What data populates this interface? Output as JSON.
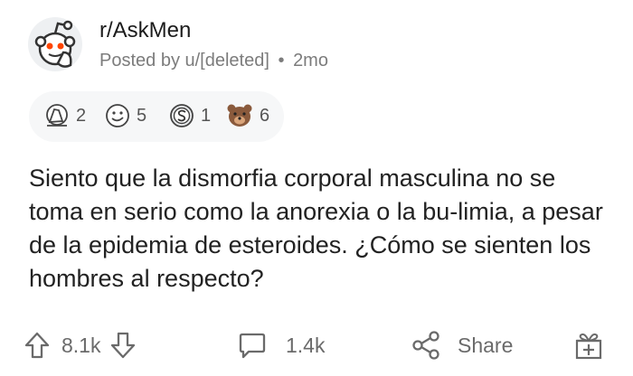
{
  "post": {
    "subreddit": "r/AskMen",
    "posted_by": "Posted by u/[deleted]",
    "separator": "•",
    "age": "2mo",
    "text": "Siento que la dismorfia corporal masculina no se toma en serio como la anorexia o la bu-limia, a pesar de la epidemia de esteroides. ¿Cómo se sienten los hombres al respecto?"
  },
  "awards": [
    {
      "icon": "facepalm-award-icon",
      "count": "2"
    },
    {
      "icon": "smile-face-award-icon",
      "count": "5"
    },
    {
      "icon": "silver-s-award-icon",
      "count": "1"
    },
    {
      "icon": "bear-award-icon",
      "count": "6"
    }
  ],
  "actions": {
    "upvote_count": "8.1k",
    "comment_count": "1.4k",
    "share_label": "Share"
  },
  "colors": {
    "text": "#222222",
    "muted": "#7c7c7c",
    "icon": "#6a6a6a",
    "award_bar": "#f6f7f8"
  }
}
